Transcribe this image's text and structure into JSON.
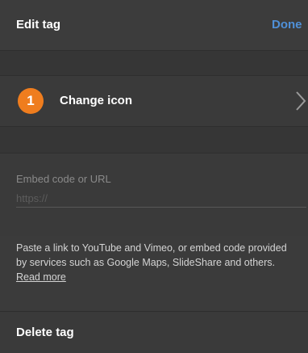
{
  "header": {
    "title": "Edit tag",
    "done_label": "Done"
  },
  "icon_row": {
    "badge_number": "1",
    "label": "Change icon",
    "chevron_icon": "chevron-right-icon"
  },
  "embed": {
    "label": "Embed code or URL",
    "value": "",
    "placeholder": "https://"
  },
  "hint": {
    "text": "Paste a link to YouTube and Vimeo, or embed code provided by services such as Google Maps, SlideShare and others.",
    "link_label": "Read more"
  },
  "delete": {
    "label": "Delete tag"
  },
  "colors": {
    "accent_blue": "#4f90d8",
    "badge_orange": "#ef7d1e",
    "panel_bg": "#3a3a3a"
  }
}
